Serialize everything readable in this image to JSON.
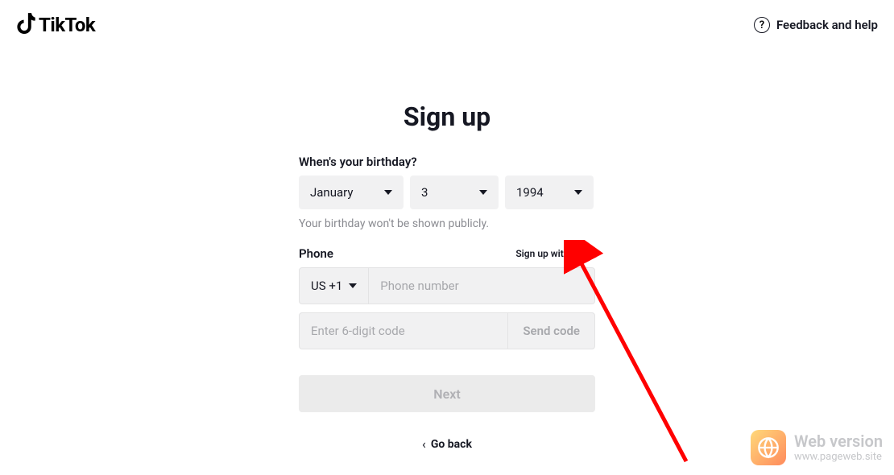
{
  "header": {
    "logo_text": "TikTok",
    "feedback_label": "Feedback and help"
  },
  "form": {
    "title": "Sign up",
    "birthday_label": "When's your birthday?",
    "month": "January",
    "day": "3",
    "year": "1994",
    "birthday_hint": "Your birthday won't be shown publicly.",
    "phone_label": "Phone",
    "email_link": "Sign up with email",
    "country_code": "US +1",
    "phone_placeholder": "Phone number",
    "code_placeholder": "Enter 6-digit code",
    "send_code_label": "Send code",
    "next_label": "Next",
    "go_back_label": "Go back"
  },
  "watermark": {
    "title": "Web version",
    "url": "www.pageweb.site"
  }
}
